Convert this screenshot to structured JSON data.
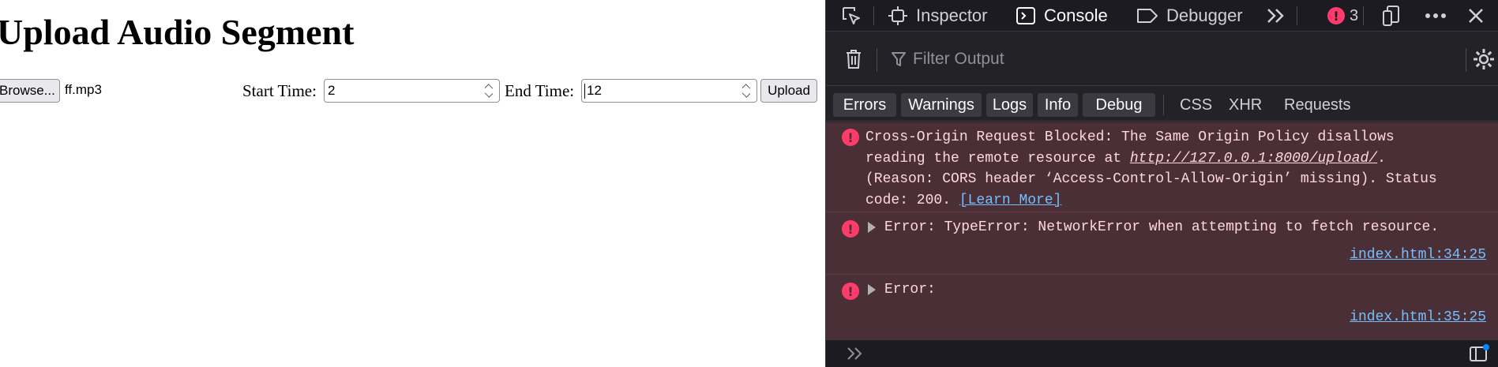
{
  "page": {
    "title": "Upload Audio Segment",
    "browse_label": "Browse...",
    "file_name": "ff.mp3",
    "start_label": "Start Time:",
    "start_value": "2",
    "end_label": "End Time:",
    "end_value": "12",
    "upload_label": "Upload"
  },
  "devtools": {
    "tabs": [
      {
        "label": "Inspector",
        "icon": "inspector-icon"
      },
      {
        "label": "Console",
        "icon": "console-icon",
        "active": true
      },
      {
        "label": "Debugger",
        "icon": "debugger-icon"
      }
    ],
    "error_count": "3",
    "filter_placeholder": "Filter Output",
    "levels": [
      "Errors",
      "Warnings",
      "Logs",
      "Info",
      "Debug"
    ],
    "requests": [
      "CSS",
      "XHR",
      "Requests"
    ],
    "messages": [
      {
        "line1": "Cross-Origin Request Blocked: The Same Origin Policy disallows",
        "line2_prefix": "reading the remote resource at ",
        "line2_link": "http://127.0.0.1:8000/upload/",
        "line2_suffix": ".",
        "line3": "(Reason: CORS header ‘Access-Control-Allow-Origin’ missing). Status",
        "line4_prefix": "code: 200. ",
        "learn_more": "[Learn More]"
      },
      {
        "text": "Error: TypeError: NetworkError when attempting to fetch resource.",
        "source": "index.html:34:25"
      },
      {
        "text": "Error:",
        "source": "index.html:35:25"
      }
    ],
    "colors": {
      "error_bg": "#4b2f36",
      "error_icon": "#ff3b6b",
      "link": "#75bfff",
      "panel_bg": "#232327"
    }
  }
}
